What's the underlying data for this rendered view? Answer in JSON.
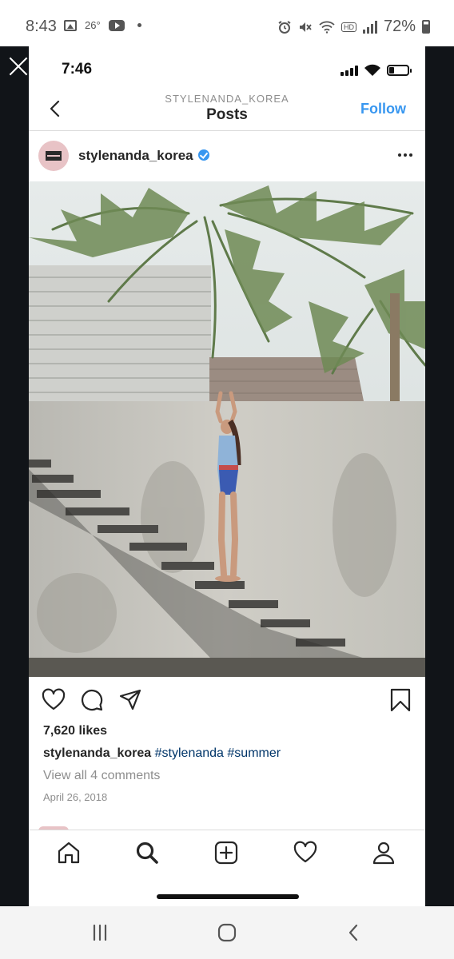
{
  "android_status": {
    "time": "8:43",
    "temperature": "26°",
    "battery": "72%",
    "icons": [
      "gallery-icon",
      "youtube-icon",
      "notification-dot-icon",
      "alarm-icon",
      "mute-icon",
      "wifi-icon",
      "hd-icon",
      "signal-icon",
      "battery-icon"
    ]
  },
  "viewer": {
    "close_icon": "close-icon"
  },
  "ios_status": {
    "time": "7:46",
    "icons": [
      "cell-signal-icon",
      "wifi-icon",
      "battery-icon"
    ]
  },
  "header": {
    "subtitle": "STYLENANDA_KOREA",
    "title": "Posts",
    "follow_label": "Follow",
    "back_icon": "chevron-left-icon"
  },
  "post": {
    "username": "stylenanda_korea",
    "verified": true,
    "likes": "7,620 likes",
    "caption_user": "stylenanda_korea",
    "caption_tags": [
      "#stylenanda",
      "#summer"
    ],
    "view_comments": "View all 4 comments",
    "date": "April 26, 2018",
    "actions": [
      "heart-icon",
      "comment-icon",
      "share-icon",
      "bookmark-icon"
    ]
  },
  "tabbar": {
    "tabs": [
      "home-icon",
      "search-icon",
      "new-post-icon",
      "activity-heart-icon",
      "profile-icon"
    ]
  },
  "android_nav": {
    "buttons": [
      "recent-apps-icon",
      "home-icon",
      "back-icon"
    ]
  },
  "colors": {
    "accent_blue": "#3897f0",
    "hashtag": "#003569",
    "viewer_bg": "#111418"
  }
}
